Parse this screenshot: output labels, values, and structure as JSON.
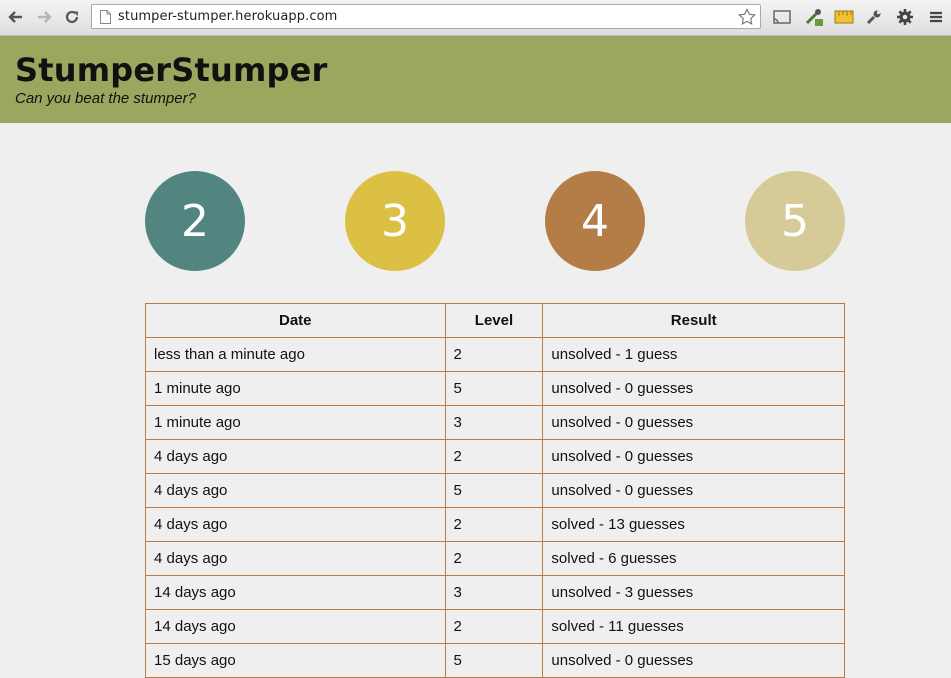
{
  "browser": {
    "url": "stumper-stumper.herokuapp.com"
  },
  "header": {
    "title": "StumperStumper",
    "tagline": "Can you beat the stumper?"
  },
  "levels": [
    {
      "label": "2",
      "color": "#528580"
    },
    {
      "label": "3",
      "color": "#dcc044"
    },
    {
      "label": "4",
      "color": "#b47d47"
    },
    {
      "label": "5",
      "color": "#d6cb98"
    }
  ],
  "table": {
    "headers": [
      "Date",
      "Level",
      "Result"
    ],
    "rows": [
      [
        "less than a minute ago",
        "2",
        "unsolved - 1 guess"
      ],
      [
        "1 minute ago",
        "5",
        "unsolved - 0 guesses"
      ],
      [
        "1 minute ago",
        "3",
        "unsolved - 0 guesses"
      ],
      [
        "4 days ago",
        "2",
        "unsolved - 0 guesses"
      ],
      [
        "4 days ago",
        "5",
        "unsolved - 0 guesses"
      ],
      [
        "4 days ago",
        "2",
        "solved - 13 guesses"
      ],
      [
        "4 days ago",
        "2",
        "solved - 6 guesses"
      ],
      [
        "14 days ago",
        "3",
        "unsolved - 3 guesses"
      ],
      [
        "14 days ago",
        "2",
        "solved - 11 guesses"
      ],
      [
        "15 days ago",
        "5",
        "unsolved - 0 guesses"
      ]
    ]
  }
}
